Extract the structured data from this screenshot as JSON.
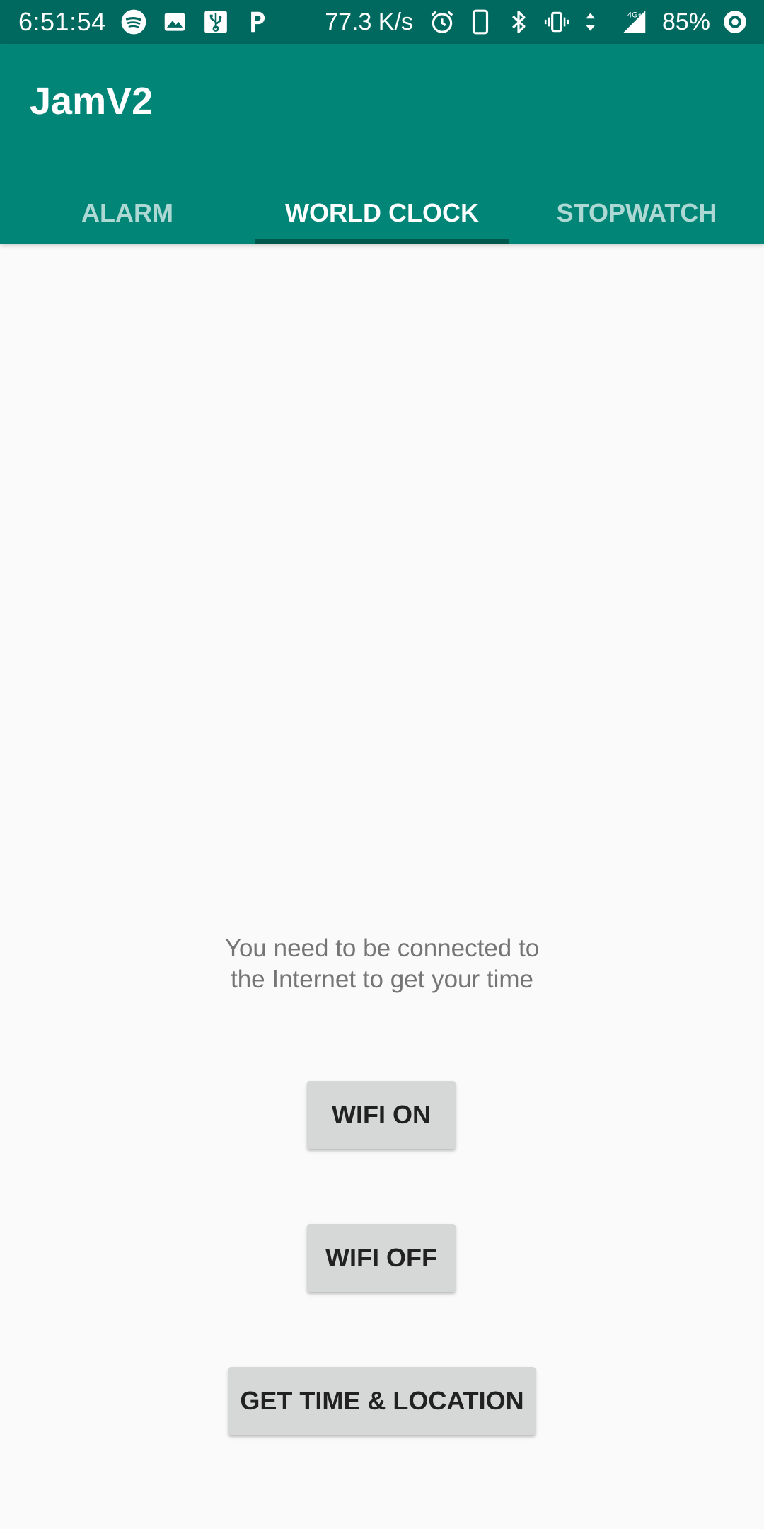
{
  "status_bar": {
    "time": "6:51:54",
    "left_icons": [
      "spotify-icon",
      "image-icon",
      "usb-icon",
      "parking-icon"
    ],
    "net_speed": "77.3 K/s",
    "right_icons": [
      "alarm-icon",
      "phone-icon",
      "bluetooth-icon",
      "vibrate-icon",
      "data-arrows-icon",
      "signal-icon"
    ],
    "network_type": "4G+",
    "battery": "85%"
  },
  "app": {
    "title": "JamV2",
    "colors": {
      "status_bar": "#00695f",
      "app_bar": "#008577",
      "tab_indicator": "#00574b",
      "background": "#fafafa",
      "button": "#d6d7d7"
    }
  },
  "tabs": [
    {
      "label": "ALARM",
      "active": false
    },
    {
      "label": "WORLD CLOCK",
      "active": true
    },
    {
      "label": "STOPWATCH",
      "active": false
    }
  ],
  "main": {
    "message_line1": "You need to be connected to",
    "message_line2": "the Internet to get your time",
    "buttons": {
      "wifi_on": "WIFI ON",
      "wifi_off": "WIFI OFF",
      "get_time_location": "GET TIME & LOCATION"
    }
  }
}
